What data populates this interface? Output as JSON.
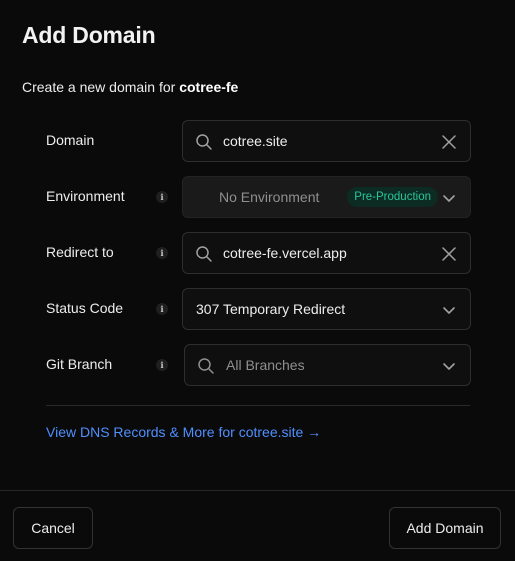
{
  "dialog": {
    "title": "Add Domain",
    "subtitle_prefix": "Create a new domain for",
    "project_name": "cotree-fe"
  },
  "form": {
    "domain": {
      "label": "Domain",
      "value": "cotree.site"
    },
    "environment": {
      "label": "Environment",
      "value": "No Environment",
      "badge": "Pre-Production"
    },
    "redirect": {
      "label": "Redirect to",
      "value": "cotree-fe.vercel.app"
    },
    "status_code": {
      "label": "Status Code",
      "value": "307 Temporary Redirect"
    },
    "git_branch": {
      "label": "Git Branch",
      "placeholder": "All Branches"
    }
  },
  "dns_link": "View DNS Records & More for cotree.site →",
  "footer": {
    "cancel_label": "Cancel",
    "add_label": "Add Domain"
  },
  "colors": {
    "background": "#0a0a0a",
    "link": "#4f8fff",
    "badge_text": "#29c59a",
    "badge_bg": "#0c2b22",
    "border": "#2e2e2e"
  },
  "icons": {
    "search": "search-icon",
    "clear": "close-icon",
    "chevron": "chevron-down-icon",
    "info": "info-icon"
  }
}
